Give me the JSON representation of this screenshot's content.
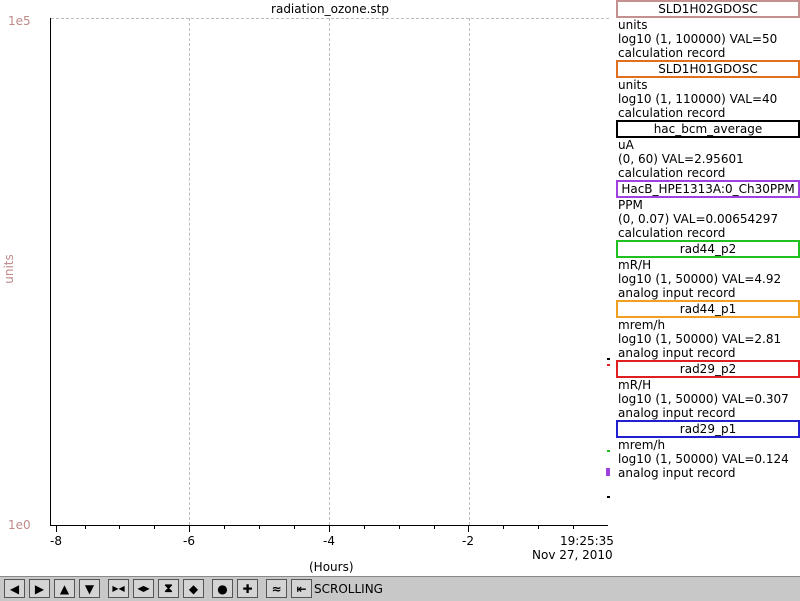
{
  "title": "radiation_ozone.stp",
  "y_axis": {
    "label": "units",
    "top_tick": "1e5",
    "bottom_tick": "1e0"
  },
  "x_axis": {
    "label": "(Hours)",
    "ticks": [
      "-8",
      "-6",
      "-4",
      "-2"
    ],
    "end_time": "19:25:35",
    "end_date": "Nov 27, 2010"
  },
  "legend": [
    {
      "name": "SLD1H02GDOSC",
      "color": "#c49090",
      "units": "units",
      "range": "log10 (1, 100000) VAL=50",
      "type": "calculation record"
    },
    {
      "name": "SLD1H01GDOSC",
      "color": "#e07020",
      "units": "units",
      "range": "log10 (1, 110000) VAL=40",
      "type": "calculation record"
    },
    {
      "name": "hac_bcm_average",
      "color": "#000000",
      "units": "uA",
      "range": "(0, 60) VAL=2.95601",
      "type": "calculation record"
    },
    {
      "name": "HacB_HPE1313A:0_Ch30PPM",
      "color": "#a040e0",
      "units": "PPM",
      "range": "(0, 0.07) VAL=0.00654297",
      "type": "calculation record"
    },
    {
      "name": "rad44_p2",
      "color": "#20c020",
      "units": "mR/H",
      "range": "log10 (1, 50000) VAL=4.92",
      "type": "analog input record"
    },
    {
      "name": "rad44_p1",
      "color": "#f0a020",
      "units": "mrem/h",
      "range": "log10 (1, 50000) VAL=2.81",
      "type": "analog input record"
    },
    {
      "name": "rad29_p2",
      "color": "#e02020",
      "units": "mR/H",
      "range": "log10 (1, 50000) VAL=0.307",
      "type": "analog input record"
    },
    {
      "name": "rad29_p1",
      "color": "#2020d0",
      "units": "mrem/h",
      "range": "log10 (1, 50000) VAL=0.124",
      "type": "analog input record"
    }
  ],
  "toolbar": {
    "mode": "SCROLLING",
    "buttons": [
      {
        "icon": "arrow-left-icon",
        "glyph": "◀"
      },
      {
        "icon": "arrow-right-icon",
        "glyph": "▶"
      },
      {
        "icon": "arrow-up-icon",
        "glyph": "▲"
      },
      {
        "icon": "arrow-down-icon",
        "glyph": "▼"
      },
      {
        "icon": "zoom-in-horizontal-icon",
        "glyph": "▶◀"
      },
      {
        "icon": "zoom-out-horizontal-icon",
        "glyph": "◀▶"
      },
      {
        "icon": "zoom-in-vertical-icon",
        "glyph": "⧗"
      },
      {
        "icon": "zoom-out-vertical-icon",
        "glyph": "◆"
      },
      {
        "icon": "record-icon",
        "glyph": "●"
      },
      {
        "icon": "add-icon",
        "glyph": "✚"
      },
      {
        "icon": "config-icon",
        "glyph": "≈"
      },
      {
        "icon": "scroll-end-icon",
        "glyph": "⇤"
      }
    ]
  }
}
